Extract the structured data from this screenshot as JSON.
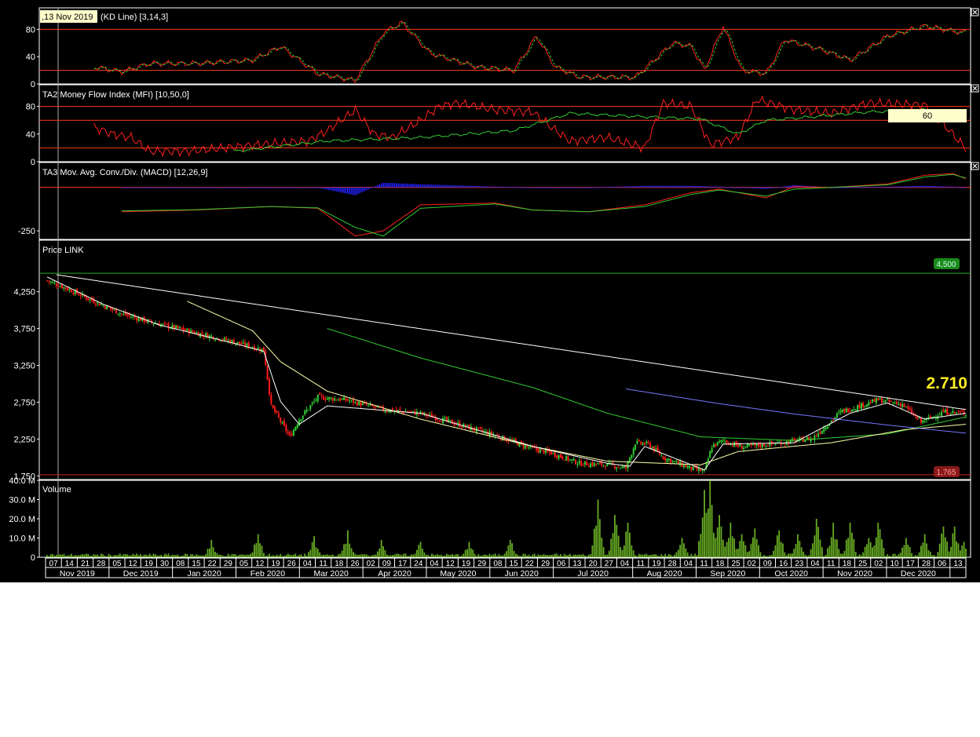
{
  "colors": {
    "background": "#000000",
    "frame": "#ffffff",
    "up_candle": "#33cc33",
    "down_candle": "#ff1a1a",
    "ref_line": "#ff3b1f",
    "k_line": "#ff2020",
    "d_line": "#33cc33",
    "macd_line": "#ff2020",
    "signal_line": "#33cc33",
    "histogram": "#2222ff",
    "volume_bar": "#66aa22",
    "ma_short": "#ffffff",
    "ma_mid": "#ffffaa",
    "ma_long": "#33cc33",
    "trendline": "#ffffff",
    "ma_200": "#7777ff",
    "resistance_line": "#22aa22",
    "support_line": "#cc2222",
    "last_price_text": "#ffee22",
    "cursor_line": "#aaaaaa",
    "tooltip_bg": "#ffffcc"
  },
  "cursor": {
    "date_label": ",13 Nov 2019"
  },
  "timeline": {
    "day_labels": [
      "07",
      "14",
      "21",
      "28",
      "05",
      "12",
      "19",
      "30",
      "08",
      "15",
      "22",
      "29",
      "05",
      "12",
      "19",
      "26",
      "04",
      "11",
      "18",
      "26",
      "02",
      "09",
      "17",
      "24",
      "04",
      "12",
      "19",
      "29",
      "08",
      "15",
      "22",
      "29",
      "06",
      "13",
      "20",
      "27",
      "04",
      "11",
      "19",
      "28",
      "04",
      "11",
      "18",
      "25",
      "02",
      "09",
      "16",
      "23",
      "04",
      "11",
      "18",
      "25",
      "02",
      "10",
      "17",
      "28",
      "06",
      "13"
    ],
    "months": [
      {
        "label": "Nov 2019",
        "start": 0,
        "end": 4
      },
      {
        "label": "Dec 2019",
        "start": 4,
        "end": 8
      },
      {
        "label": "Jan 2020",
        "start": 8,
        "end": 12
      },
      {
        "label": "Feb 2020",
        "start": 12,
        "end": 16
      },
      {
        "label": "Mar 2020",
        "start": 16,
        "end": 20
      },
      {
        "label": "Apr 2020",
        "start": 20,
        "end": 24
      },
      {
        "label": "May 2020",
        "start": 24,
        "end": 28
      },
      {
        "label": "Jun 2020",
        "start": 28,
        "end": 32
      },
      {
        "label": "Jul 2020",
        "start": 32,
        "end": 37
      },
      {
        "label": "Aug 2020",
        "start": 37,
        "end": 41
      },
      {
        "label": "Sep 2020",
        "start": 41,
        "end": 45
      },
      {
        "label": "Oct 2020",
        "start": 45,
        "end": 49
      },
      {
        "label": "Nov 2020",
        "start": 49,
        "end": 53
      },
      {
        "label": "Dec 2020",
        "start": 53,
        "end": 57
      },
      {
        "label": "",
        "start": 57,
        "end": 58
      }
    ]
  },
  "panels": {
    "kd": {
      "title": "(KD Line) [3,14,3]",
      "y_ticks": [
        "80",
        "40",
        "0"
      ],
      "y_tick_values": [
        80,
        40,
        0
      ],
      "ylim": [
        0,
        100
      ],
      "ref_lines": [
        80,
        20
      ]
    },
    "mfi": {
      "title": "TA2 Money Flow Index (MFI) [10,50,0]",
      "y_ticks": [
        "80",
        "40",
        "0"
      ],
      "y_tick_values": [
        80,
        40,
        0
      ],
      "ylim": [
        0,
        100
      ],
      "ref_lines": [
        80,
        60,
        20
      ],
      "value_tag": "60"
    },
    "macd": {
      "title": "TA3 Mov. Avg. Conv./Div. (MACD) [12,26,9]",
      "y_ticks": [
        "-250"
      ],
      "y_tick_values": [
        -250
      ],
      "ylim": [
        -290,
        130
      ]
    },
    "price": {
      "title": "Price LINK",
      "y_ticks": [
        "4,250",
        "3,750",
        "3,250",
        "2,750",
        "2,250",
        "1,750"
      ],
      "y_tick_values": [
        4250,
        3750,
        3250,
        2750,
        2250,
        1750
      ],
      "ylim": [
        1700,
        4800
      ],
      "resistance_tag": "4,500",
      "resistance_value": 4500,
      "support_tag": "1,765",
      "support_value": 1765,
      "last_price": "2.710"
    },
    "volume": {
      "title": "Volume",
      "y_ticks": [
        "40.0 M",
        "30.0 M",
        "20.0 M",
        "10.0 M",
        "0"
      ],
      "y_tick_values": [
        40,
        30,
        20,
        10,
        0
      ],
      "ylim": [
        0,
        40
      ]
    }
  },
  "chart_data": {
    "type": "candlestick",
    "x": "trading days, Nov 2019 - Dec 2020",
    "close_anchors": [
      [
        0,
        4400
      ],
      [
        10,
        4300
      ],
      [
        25,
        4120
      ],
      [
        40,
        3950
      ],
      [
        55,
        3840
      ],
      [
        75,
        3720
      ],
      [
        95,
        3600
      ],
      [
        110,
        3500
      ],
      [
        116,
        3460
      ],
      [
        120,
        2700
      ],
      [
        126,
        2450
      ],
      [
        130,
        2280
      ],
      [
        135,
        2520
      ],
      [
        145,
        2820
      ],
      [
        160,
        2780
      ],
      [
        180,
        2650
      ],
      [
        200,
        2600
      ],
      [
        220,
        2450
      ],
      [
        240,
        2300
      ],
      [
        260,
        2120
      ],
      [
        270,
        2060
      ],
      [
        285,
        1920
      ],
      [
        300,
        1900
      ],
      [
        310,
        1860
      ],
      [
        315,
        2200
      ],
      [
        322,
        2180
      ],
      [
        330,
        2000
      ],
      [
        345,
        1850
      ],
      [
        352,
        1810
      ],
      [
        356,
        2150
      ],
      [
        362,
        2230
      ],
      [
        372,
        2140
      ],
      [
        390,
        2190
      ],
      [
        410,
        2260
      ],
      [
        425,
        2620
      ],
      [
        445,
        2780
      ],
      [
        458,
        2720
      ],
      [
        468,
        2480
      ],
      [
        480,
        2620
      ],
      [
        492,
        2600
      ]
    ],
    "ma_short_anchors": [
      [
        0,
        4450
      ],
      [
        30,
        4080
      ],
      [
        60,
        3800
      ],
      [
        100,
        3550
      ],
      [
        116,
        3440
      ],
      [
        125,
        2760
      ],
      [
        135,
        2450
      ],
      [
        150,
        2700
      ],
      [
        200,
        2600
      ],
      [
        260,
        2150
      ],
      [
        300,
        1920
      ],
      [
        312,
        1880
      ],
      [
        320,
        2150
      ],
      [
        335,
        2000
      ],
      [
        352,
        1830
      ],
      [
        362,
        2180
      ],
      [
        400,
        2200
      ],
      [
        430,
        2600
      ],
      [
        450,
        2740
      ],
      [
        470,
        2520
      ],
      [
        492,
        2600
      ]
    ],
    "ma_mid_anchors": [
      [
        75,
        4120
      ],
      [
        110,
        3720
      ],
      [
        125,
        3300
      ],
      [
        150,
        2900
      ],
      [
        200,
        2520
      ],
      [
        260,
        2150
      ],
      [
        300,
        1950
      ],
      [
        350,
        1900
      ],
      [
        370,
        2080
      ],
      [
        420,
        2200
      ],
      [
        460,
        2380
      ],
      [
        492,
        2450
      ]
    ],
    "ma_long_anchors": [
      [
        150,
        3750
      ],
      [
        200,
        3350
      ],
      [
        260,
        2950
      ],
      [
        300,
        2600
      ],
      [
        350,
        2280
      ],
      [
        400,
        2230
      ],
      [
        450,
        2320
      ],
      [
        492,
        2550
      ]
    ],
    "ma_200_anchors": [
      [
        310,
        2930
      ],
      [
        360,
        2730
      ],
      [
        400,
        2590
      ],
      [
        450,
        2440
      ],
      [
        492,
        2330
      ]
    ],
    "trendline": [
      [
        5,
        4480
      ],
      [
        492,
        2650
      ]
    ],
    "kd_k_anchors": [
      [
        25,
        25
      ],
      [
        40,
        18
      ],
      [
        55,
        30
      ],
      [
        80,
        30
      ],
      [
        110,
        35
      ],
      [
        125,
        55
      ],
      [
        145,
        15
      ],
      [
        165,
        5
      ],
      [
        180,
        75
      ],
      [
        190,
        90
      ],
      [
        205,
        45
      ],
      [
        230,
        25
      ],
      [
        250,
        20
      ],
      [
        262,
        70
      ],
      [
        272,
        25
      ],
      [
        285,
        10
      ],
      [
        315,
        10
      ],
      [
        335,
        60
      ],
      [
        345,
        55
      ],
      [
        352,
        20
      ],
      [
        362,
        85
      ],
      [
        372,
        20
      ],
      [
        385,
        15
      ],
      [
        395,
        65
      ],
      [
        415,
        50
      ],
      [
        430,
        35
      ],
      [
        450,
        70
      ],
      [
        470,
        85
      ],
      [
        490,
        75
      ],
      [
        505,
        90
      ],
      [
        520,
        10
      ],
      [
        530,
        50
      ],
      [
        535,
        80
      ],
      [
        540,
        70
      ],
      [
        545,
        60
      ]
    ],
    "mfi_anchors": [
      [
        25,
        50
      ],
      [
        35,
        40
      ],
      [
        45,
        35
      ],
      [
        55,
        15
      ],
      [
        75,
        15
      ],
      [
        95,
        20
      ],
      [
        115,
        25
      ],
      [
        140,
        30
      ],
      [
        150,
        45
      ],
      [
        165,
        75
      ],
      [
        175,
        40
      ],
      [
        185,
        35
      ],
      [
        200,
        60
      ],
      [
        210,
        80
      ],
      [
        220,
        85
      ],
      [
        240,
        75
      ],
      [
        260,
        72
      ],
      [
        270,
        50
      ],
      [
        280,
        30
      ],
      [
        300,
        35
      ],
      [
        320,
        20
      ],
      [
        330,
        85
      ],
      [
        345,
        80
      ],
      [
        355,
        25
      ],
      [
        370,
        35
      ],
      [
        380,
        90
      ],
      [
        400,
        75
      ],
      [
        420,
        70
      ],
      [
        440,
        85
      ],
      [
        470,
        82
      ],
      [
        485,
        40
      ],
      [
        495,
        10
      ],
      [
        505,
        70
      ],
      [
        510,
        60
      ]
    ],
    "mfi_signal_anchors": [
      [
        100,
        15
      ],
      [
        150,
        30
      ],
      [
        200,
        35
      ],
      [
        250,
        45
      ],
      [
        280,
        70
      ],
      [
        320,
        65
      ],
      [
        350,
        62
      ],
      [
        370,
        40
      ],
      [
        385,
        60
      ],
      [
        410,
        65
      ],
      [
        440,
        72
      ],
      [
        470,
        75
      ],
      [
        510,
        70
      ]
    ],
    "macd_anchors": [
      [
        40,
        -140
      ],
      [
        80,
        -130
      ],
      [
        120,
        -110
      ],
      [
        145,
        -120
      ],
      [
        165,
        -280
      ],
      [
        180,
        -250
      ],
      [
        200,
        -100
      ],
      [
        240,
        -90
      ],
      [
        260,
        -130
      ],
      [
        290,
        -140
      ],
      [
        320,
        -100
      ],
      [
        345,
        -30
      ],
      [
        360,
        -10
      ],
      [
        385,
        -60
      ],
      [
        400,
        5
      ],
      [
        420,
        0
      ],
      [
        450,
        20
      ],
      [
        470,
        70
      ],
      [
        485,
        80
      ],
      [
        500,
        15
      ],
      [
        510,
        0
      ]
    ],
    "signal_anchors": [
      [
        40,
        -135
      ],
      [
        80,
        -128
      ],
      [
        120,
        -110
      ],
      [
        145,
        -118
      ],
      [
        165,
        -230
      ],
      [
        180,
        -280
      ],
      [
        200,
        -120
      ],
      [
        240,
        -95
      ],
      [
        260,
        -130
      ],
      [
        290,
        -140
      ],
      [
        320,
        -110
      ],
      [
        345,
        -40
      ],
      [
        360,
        -15
      ],
      [
        385,
        -50
      ],
      [
        400,
        -10
      ],
      [
        420,
        0
      ],
      [
        450,
        15
      ],
      [
        470,
        60
      ],
      [
        485,
        75
      ],
      [
        500,
        30
      ],
      [
        510,
        5
      ]
    ],
    "volume_baseline_m": 1.2,
    "volume_spikes_m": [
      [
        88,
        9
      ],
      [
        113,
        12
      ],
      [
        143,
        11
      ],
      [
        161,
        14
      ],
      [
        179,
        9
      ],
      [
        200,
        8
      ],
      [
        226,
        8
      ],
      [
        248,
        9
      ],
      [
        295,
        30
      ],
      [
        304,
        22
      ],
      [
        311,
        18
      ],
      [
        340,
        10
      ],
      [
        352,
        35
      ],
      [
        355,
        40
      ],
      [
        360,
        22
      ],
      [
        366,
        18
      ],
      [
        372,
        12
      ],
      [
        379,
        15
      ],
      [
        392,
        14
      ],
      [
        402,
        12
      ],
      [
        412,
        20
      ],
      [
        421,
        18
      ],
      [
        430,
        18
      ],
      [
        440,
        10
      ],
      [
        445,
        18
      ],
      [
        460,
        10
      ],
      [
        470,
        12
      ],
      [
        480,
        16
      ],
      [
        486,
        16
      ],
      [
        491,
        8
      ]
    ]
  }
}
